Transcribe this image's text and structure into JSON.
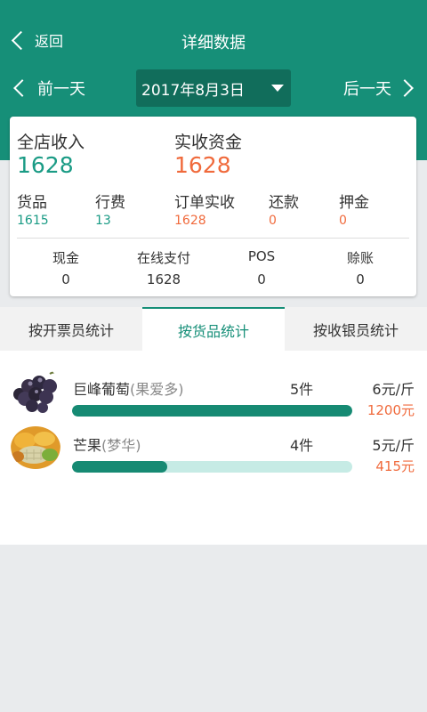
{
  "header": {
    "back_label": "返回",
    "title": "详细数据",
    "prev_label": "前一天",
    "next_label": "后一天",
    "date": "2017年8月3日",
    "bg_color": "#168f78"
  },
  "summary": {
    "store_income_label": "全店收入",
    "store_income_value": "1628",
    "received_funds_label": "实收资金",
    "received_funds_value": "1628",
    "stats": [
      {
        "label": "货品",
        "value": "1615"
      },
      {
        "label": "行费",
        "value": "13"
      },
      {
        "label": "订单实收",
        "value": "1628"
      },
      {
        "label": "还款",
        "value": "0"
      },
      {
        "label": "押金",
        "value": "0"
      }
    ],
    "payments": [
      {
        "label": "现金",
        "value": "0"
      },
      {
        "label": "在线支付",
        "value": "1628"
      },
      {
        "label": "POS",
        "value": "0"
      },
      {
        "label": "赊账",
        "value": "0"
      }
    ]
  },
  "tabs": [
    {
      "label": "按开票员统计"
    },
    {
      "label": "按货品统计",
      "active": true
    },
    {
      "label": "按收银员统计"
    }
  ],
  "products": [
    {
      "name": "巨峰葡萄",
      "variant": "(果爱多)",
      "count": "5件",
      "unit_price": "6元/斤",
      "total": "1200元",
      "progress": 1.0,
      "icon": "grape-thumbnail"
    },
    {
      "name": "芒果",
      "variant": "(梦华)",
      "count": "4件",
      "unit_price": "5元/斤",
      "total": "415元",
      "progress": 0.34,
      "icon": "mango-thumbnail"
    }
  ],
  "colors": {
    "accent": "#168f78",
    "teal_text": "#1a9b85",
    "orange_text": "#f06a3c",
    "progress_fill": "#168a73",
    "progress_track": "#c6ebe5"
  }
}
